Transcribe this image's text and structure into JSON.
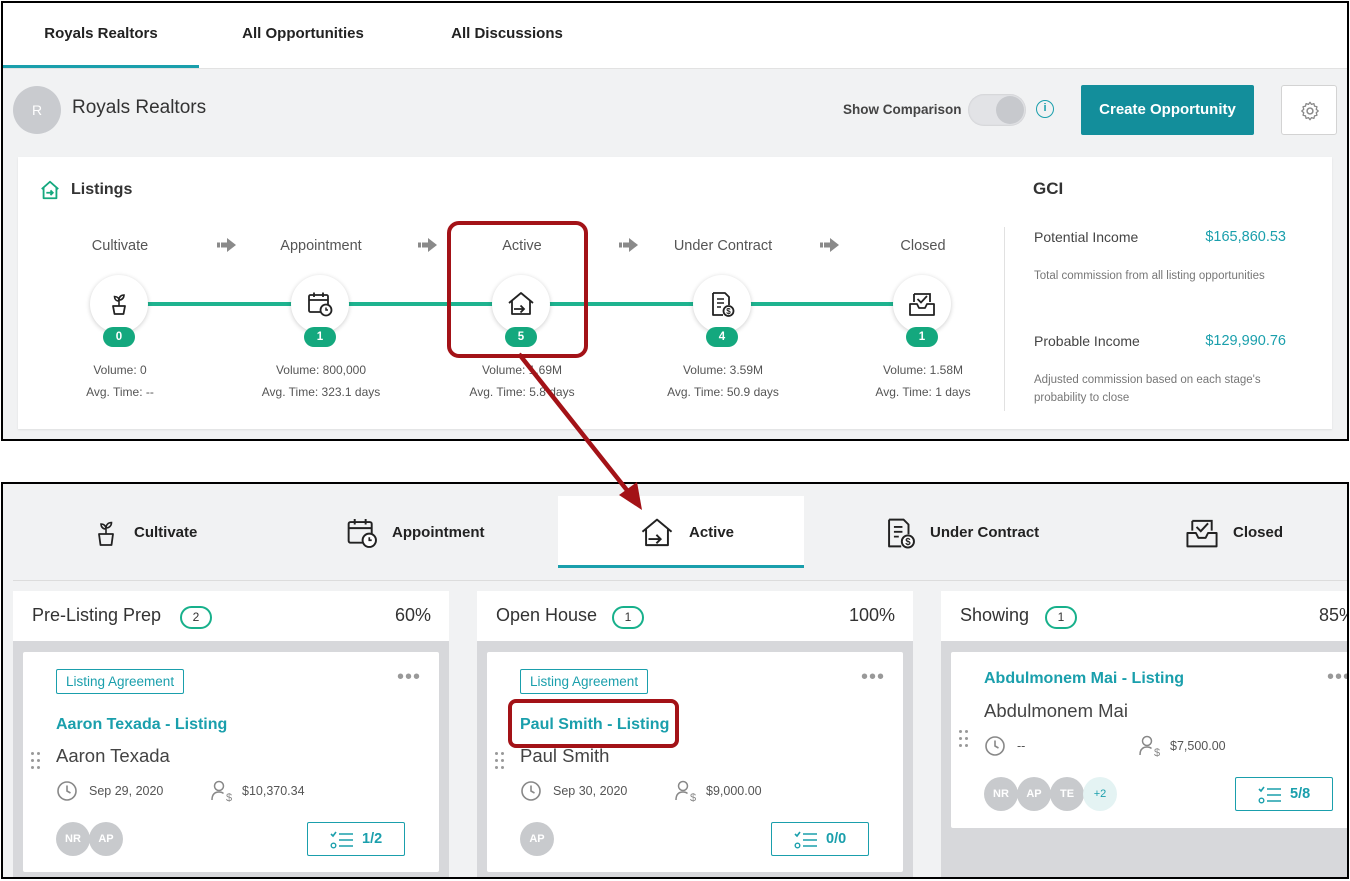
{
  "top": {
    "tabs": [
      "Royals Realtors",
      "All Opportunities",
      "All Discussions"
    ],
    "avatar_letter": "R",
    "org_name": "Royals Realtors",
    "show_comparison": "Show Comparison",
    "info_symbol": "i",
    "create_button": "Create Opportunity",
    "listings_title": "Listings",
    "stages": [
      {
        "name": "Cultivate",
        "count": "0",
        "volume": "Volume: 0",
        "avg_time": "Avg. Time: --",
        "icon": "plant-icon"
      },
      {
        "name": "Appointment",
        "count": "1",
        "volume": "Volume: 800,000",
        "avg_time": "Avg. Time: 323.1 days",
        "icon": "calendar-clock-icon"
      },
      {
        "name": "Active",
        "count": "5",
        "volume": "Volume: 1.69M",
        "avg_time": "Avg. Time: 5.8 days",
        "icon": "house-arrow-icon"
      },
      {
        "name": "Under Contract",
        "count": "4",
        "volume": "Volume: 3.59M",
        "avg_time": "Avg. Time: 50.9 days",
        "icon": "contract-dollar-icon"
      },
      {
        "name": "Closed",
        "count": "1",
        "volume": "Volume: 1.58M",
        "avg_time": "Avg. Time: 1 days",
        "icon": "inbox-check-icon"
      }
    ],
    "gci": {
      "title": "GCI",
      "potential_label": "Potential Income",
      "potential_value": "$165,860.53",
      "potential_desc": "Total commission from all listing opportunities",
      "probable_label": "Probable Income",
      "probable_value": "$129,990.76",
      "probable_desc": "Adjusted commission based on each stage's probability to close"
    }
  },
  "bottom": {
    "stage_tabs": [
      "Cultivate",
      "Appointment",
      "Active",
      "Under Contract",
      "Closed"
    ],
    "active_tab": "Active",
    "columns": [
      {
        "title": "Pre-Listing Prep",
        "count": "2",
        "percent": "60%",
        "card": {
          "tag": "Listing Agreement",
          "title": "Aaron Texada - Listing",
          "name": "Aaron Texada",
          "date": "Sep 29, 2020",
          "amount": "$10,370.34",
          "avatars": [
            "NR",
            "AP"
          ],
          "tasks": "1/2"
        }
      },
      {
        "title": "Open House",
        "count": "1",
        "percent": "100%",
        "card": {
          "tag": "Listing Agreement",
          "title": "Paul Smith - Listing",
          "name": "Paul Smith",
          "date": "Sep 30, 2020",
          "amount": "$9,000.00",
          "avatars": [
            "AP"
          ],
          "tasks": "0/0"
        }
      },
      {
        "title": "Showing",
        "count": "1",
        "percent": "85%",
        "card": {
          "title": "Abdulmonem Mai - Listing",
          "name": "Abdulmonem Mai",
          "date": "--",
          "amount": "$7,500.00",
          "avatars": [
            "NR",
            "AP",
            "TE"
          ],
          "more": "+2",
          "tasks": "5/8"
        }
      }
    ]
  },
  "colors": {
    "teal": "#1a9fac",
    "green": "#14a87e",
    "highlight": "#a31217"
  },
  "more_glyph": "•••"
}
